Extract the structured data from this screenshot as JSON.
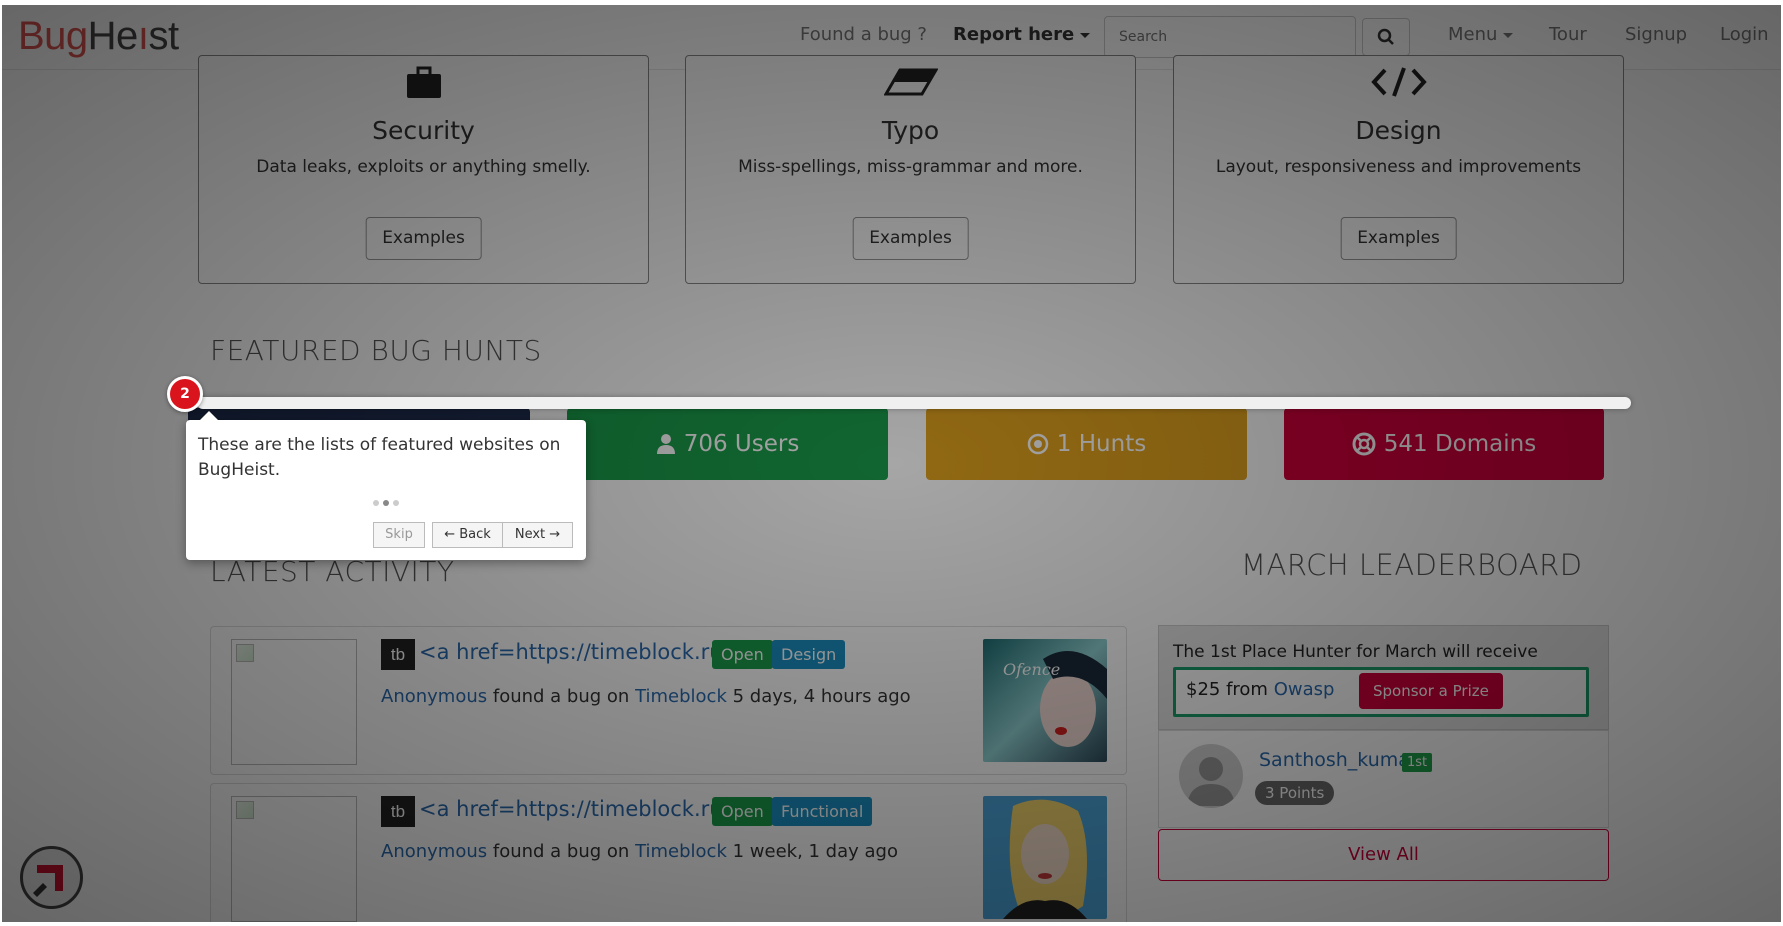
{
  "nav": {
    "logo_bug": "Bug",
    "logo_heist_a": "He",
    "logo_heist_b": "st",
    "found_a_bug": "Found a bug ?",
    "report_here": "Report here",
    "search_placeholder": "Search",
    "menu": "Menu",
    "tour": "Tour",
    "signup": "Signup",
    "login": "Login"
  },
  "categories": [
    {
      "icon": "briefcase-icon",
      "title": "Security",
      "desc": "Data leaks, exploits or anything smelly.",
      "button": "Examples"
    },
    {
      "icon": "eraser-icon",
      "title": "Typo",
      "desc": "Miss-spellings, miss-grammar and more.",
      "button": "Examples"
    },
    {
      "icon": "code-icon",
      "title": "Design",
      "desc": "Layout, responsiveness and improvements",
      "button": "Examples"
    }
  ],
  "featured": {
    "heading": "FEATURED BUG HUNTS",
    "stats": [
      {
        "icon": "user-icon",
        "label": "706 Users",
        "color": "#1a9c4a"
      },
      {
        "icon": "target-icon",
        "label": "1 Hunts",
        "color": "#e0a21e"
      },
      {
        "icon": "lifebuoy-icon",
        "label": "541 Domains",
        "color": "#d0003a"
      }
    ]
  },
  "latest_activity": {
    "heading": "LATEST ACTIVITY",
    "items": [
      {
        "logo": "tb",
        "title": "<a href=https://timeblock.ru/...",
        "status": "Open",
        "label": "Design",
        "user": "Anonymous",
        "middle": " found a bug on ",
        "domain": "Timeblock",
        "time": " 5 days, 4 hours ago"
      },
      {
        "logo": "tb",
        "title": "<a href=https://timeblock.ru/...",
        "status": "Open",
        "label": "Functional",
        "user": "Anonymous",
        "middle": " found a bug on ",
        "domain": "Timeblock",
        "time": " 1 week, 1 day ago"
      }
    ]
  },
  "leaderboard": {
    "heading": "MARCH LEADERBOARD",
    "prize_title": "The 1st Place Hunter for March will receive",
    "prize_amount": "$25 from ",
    "prize_sponsor": "Owasp",
    "sponsor_button": "Sponsor a Prize",
    "top_user": {
      "name": "Santhosh_kumar",
      "rank": "1st",
      "points": "3 Points"
    },
    "view_all": "View All"
  },
  "tour": {
    "step": "2",
    "text": "These are the lists of featured websites on BugHeist.",
    "skip": "Skip",
    "back": "← Back",
    "next": "Next →"
  },
  "colors": {
    "brand_red": "#d9534f",
    "link_blue": "#2a6aae",
    "green": "#1a9c4a",
    "amber": "#e0a21e",
    "crimson": "#d0003a",
    "badge_blue": "#1a8fc2"
  }
}
